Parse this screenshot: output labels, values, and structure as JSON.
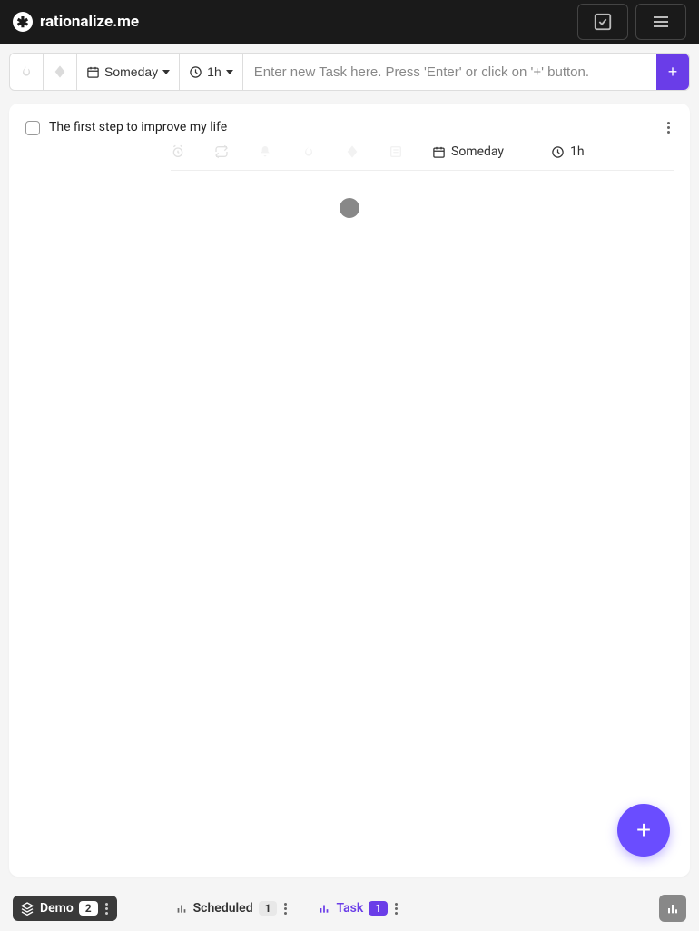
{
  "header": {
    "brand": "rationalize.me"
  },
  "toolbar": {
    "schedule_label": "Someday",
    "duration_label": "1h",
    "input_placeholder": "Enter new Task here. Press 'Enter' or click on '+' button.",
    "add_label": "+"
  },
  "tasks": [
    {
      "title": "The first step to improve my life",
      "schedule": "Someday",
      "duration": "1h"
    }
  ],
  "fab": {
    "label": "+"
  },
  "footer": {
    "demo": {
      "label": "Demo",
      "count": "2"
    },
    "scheduled": {
      "label": "Scheduled",
      "count": "1"
    },
    "task": {
      "label": "Task",
      "count": "1"
    }
  }
}
